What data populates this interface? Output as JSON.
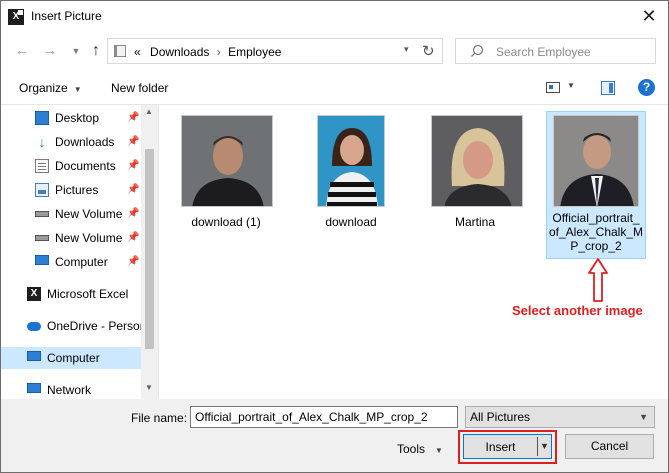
{
  "window": {
    "title": "Insert Picture",
    "app_icon": "excel-icon",
    "close_icon": "close-icon"
  },
  "address": {
    "recent_icon": "chevron-down-icon",
    "prefix": "«",
    "crumbs": [
      "Downloads",
      "Employee"
    ],
    "separator": "›",
    "refresh_icon": "refresh-icon"
  },
  "search": {
    "placeholder": "Search Employee",
    "icon": "search-icon"
  },
  "toolbar": {
    "organize_label": "Organize",
    "new_folder_label": "New folder",
    "view_icon": "view-icon",
    "preview_pane_icon": "preview-pane-icon",
    "help_label": "?"
  },
  "sidebar": {
    "items": [
      {
        "label": "Desktop",
        "icon": "desktop-icon",
        "pinned": true
      },
      {
        "label": "Downloads",
        "icon": "download-arrow-icon",
        "pinned": true
      },
      {
        "label": "Documents",
        "icon": "documents-icon",
        "pinned": true
      },
      {
        "label": "Pictures",
        "icon": "pictures-icon",
        "pinned": true
      },
      {
        "label": "New Volume",
        "icon": "drive-icon",
        "pinned": true
      },
      {
        "label": "New Volume",
        "icon": "drive-icon",
        "pinned": true
      },
      {
        "label": "Computer",
        "icon": "computer-icon",
        "pinned": true
      },
      {
        "label": "Microsoft Excel",
        "icon": "excel-icon",
        "pinned": false
      },
      {
        "label": "OneDrive - Persor",
        "icon": "onedrive-icon",
        "pinned": false
      },
      {
        "label": "Computer",
        "icon": "computer-icon",
        "pinned": false,
        "selected": true
      },
      {
        "label": "Network",
        "icon": "network-icon",
        "pinned": false
      }
    ]
  },
  "files": [
    {
      "name": "download (1)",
      "selected": false
    },
    {
      "name": "download",
      "selected": false
    },
    {
      "name": "Martina",
      "selected": false
    },
    {
      "name_lines": [
        "Official_portrait_",
        "of_Alex_Chalk_M",
        "P_crop_2"
      ],
      "selected": true
    }
  ],
  "annotation": {
    "text": "Select another image",
    "color": "#e02020"
  },
  "bottom": {
    "file_name_label": "File name:",
    "file_name_value": "Official_portrait_of_Alex_Chalk_MP_crop_2",
    "file_type_value": "All Pictures",
    "tools_label": "Tools",
    "insert_label": "Insert",
    "cancel_label": "Cancel"
  },
  "colors": {
    "accent": "#0078d7",
    "selection": "#cce8ff",
    "highlight": "#e02020"
  }
}
